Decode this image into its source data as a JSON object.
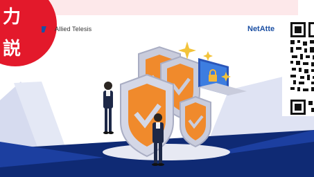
{
  "badge": {
    "line1": "力",
    "line2": "説",
    "color": "#e3192b"
  },
  "brands": {
    "allied": "Allied Telesis",
    "netattest": "NetAtte"
  },
  "colors": {
    "navy": "#0f2a74",
    "royal": "#1c3fa0",
    "lavender": "#d6dbef",
    "orange": "#f08a2c",
    "shield_grey": "#c9ccdc",
    "laptop_blue": "#3d7de0"
  },
  "icons": [
    "logo-mark-icon",
    "qr-code-icon",
    "security-illustration-icon",
    "shield-icon",
    "lock-icon",
    "laptop-icon",
    "sparkle-icon",
    "person-icon"
  ]
}
